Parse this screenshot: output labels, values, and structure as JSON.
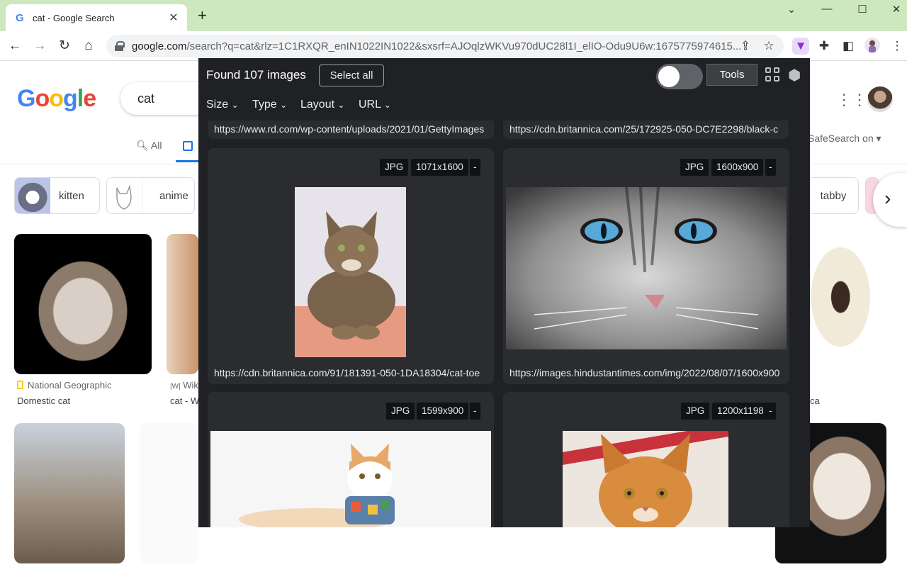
{
  "browser": {
    "tab_title": "cat - Google Search",
    "tab_logo": "G",
    "new_tab": "+",
    "url_host": "google.com",
    "url_rest": "/search?q=cat&rlz=1C1RXQR_enIN1022IN1022&sxsrf=AJOqlzWKVu970dUC28l1I_elIO-Odu9U6w:1675775974615...",
    "win_minimize": "—",
    "win_maximize": "☐",
    "win_close": "✕",
    "tabs_menu": "⌄"
  },
  "google": {
    "logo": "Google",
    "query": "cat",
    "tab_all": "All",
    "safesearch": "SafeSearch on ▾",
    "chips": [
      "kitten",
      "anime",
      "tabby"
    ],
    "results": [
      {
        "source": "National Geographic",
        "title": "Domestic cat"
      },
      {
        "source": "Wiki",
        "title": "cat - W"
      },
      {
        "source": "",
        "title": "ca"
      }
    ]
  },
  "panel": {
    "found_text": "Found 107 images",
    "select_all": "Select all",
    "tools": "Tools",
    "filters": [
      "Size",
      "Type",
      "Layout",
      "URL"
    ],
    "top_urls": [
      "https://www.rd.com/wp-content/uploads/2021/01/GettyImages",
      "https://cdn.britannica.com/25/172925-050-DC7E2298/black-c"
    ],
    "cards": [
      {
        "type": "JPG",
        "size": "1071x1600",
        "extra": "-",
        "url": "https://cdn.britannica.com/91/181391-050-1DA18304/cat-toe"
      },
      {
        "type": "JPG",
        "size": "1600x900",
        "extra": "-",
        "url": "https://images.hindustantimes.com/img/2022/08/07/1600x900"
      },
      {
        "type": "JPG",
        "size": "1599x900",
        "extra": "-",
        "url": ""
      },
      {
        "type": "JPG",
        "size": "1200x1198",
        "extra": "-",
        "url": ""
      }
    ]
  },
  "colors": {
    "tabstrip": "#cde8be",
    "panel_bg": "#202124",
    "card_bg": "#2b2c2f",
    "google_blue": "#4285f4",
    "google_red": "#ea4335",
    "google_yellow": "#fbbc05",
    "google_green": "#34a853"
  }
}
